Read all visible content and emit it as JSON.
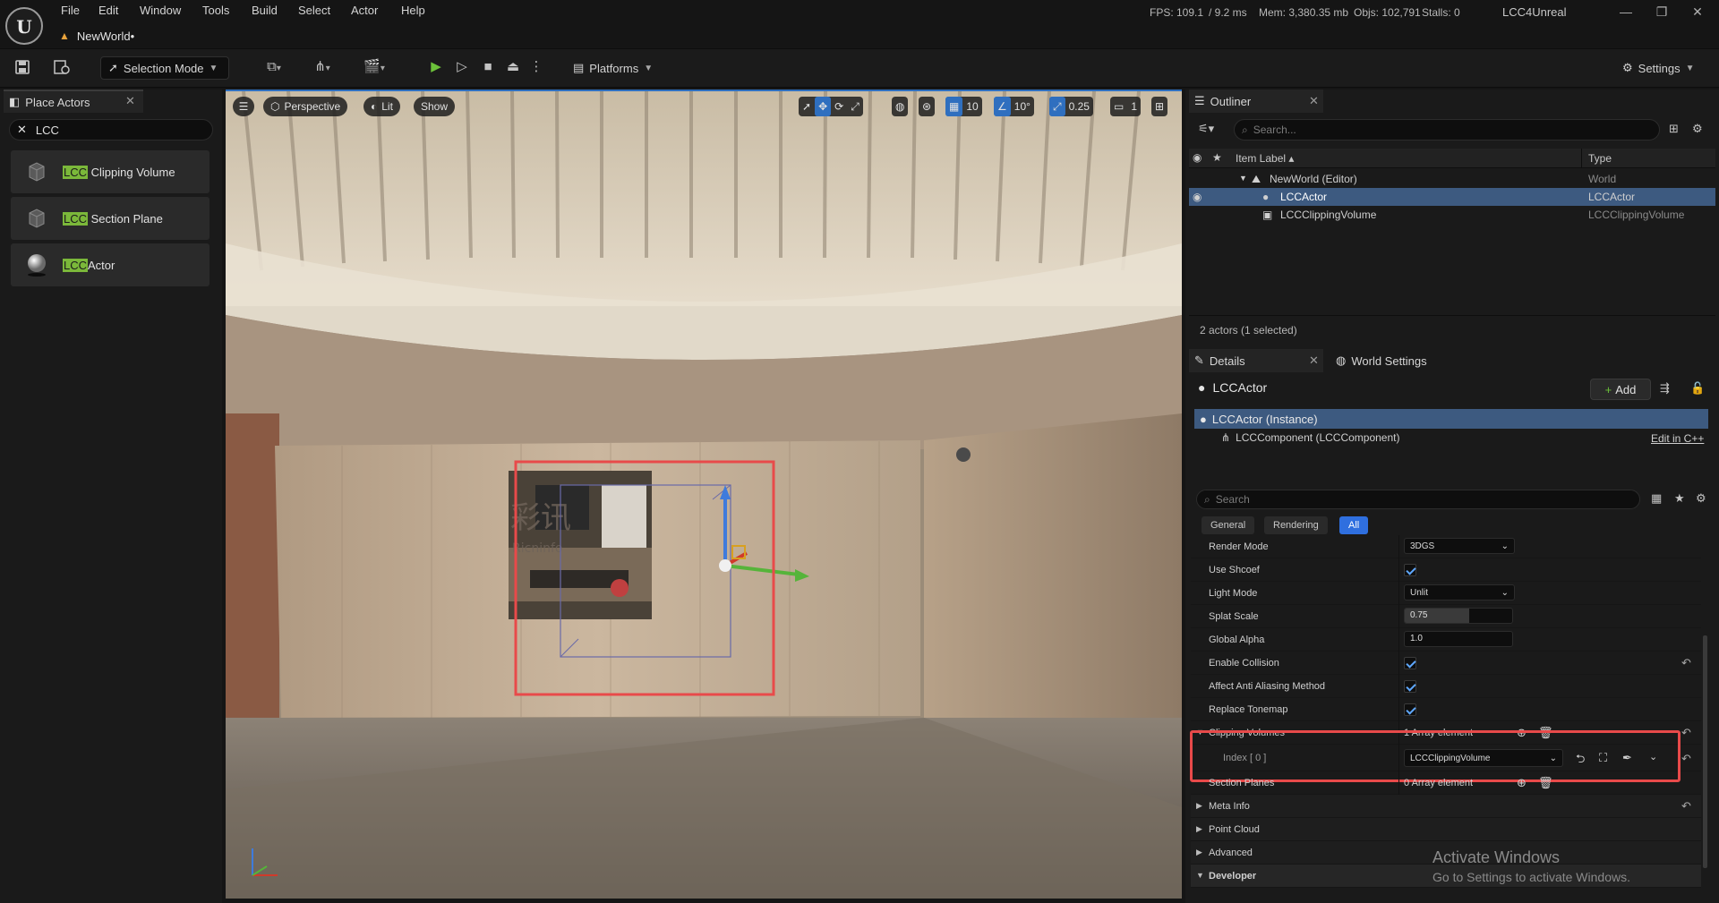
{
  "menu": [
    "File",
    "Edit",
    "Window",
    "Tools",
    "Build",
    "Select",
    "Actor",
    "Help"
  ],
  "level_tab": "NewWorld•",
  "stats": {
    "fps": "FPS: 109.1",
    "ms": "/ 9.2 ms",
    "mem": "Mem: 3,380.35 mb",
    "objs": "Objs: 102,791",
    "stalls": "Stalls: 0"
  },
  "app_name": "LCC4Unreal",
  "toolbar": {
    "selection_mode": "Selection Mode",
    "platforms": "Platforms",
    "settings": "Settings"
  },
  "place_actors": {
    "tab": "Place Actors",
    "search_value": "LCC",
    "items": [
      {
        "hl": "LCC",
        "rest": " Clipping Volume"
      },
      {
        "hl": "LCC",
        "rest": " Section Plane"
      },
      {
        "hl": "LCC",
        "rest": "Actor"
      }
    ]
  },
  "viewport": {
    "perspective": "Perspective",
    "lit": "Lit",
    "show": "Show",
    "grid_snap": "10",
    "rot_snap": "10°",
    "scale_snap": "0.25",
    "cam_speed": "1",
    "wall_text_1": "彩讯",
    "wall_text_2": "Ricninfo"
  },
  "outliner": {
    "tab": "Outliner",
    "search_placeholder": "Search...",
    "col_label": "Item Label ▴",
    "col_type": "Type",
    "rows": [
      {
        "label": "NewWorld (Editor)",
        "type": "World"
      },
      {
        "label": "LCCActor",
        "type": "LCCActor"
      },
      {
        "label": "LCCClippingVolume",
        "type": "LCCClippingVolume"
      }
    ],
    "count": "2 actors (1 selected)"
  },
  "details": {
    "tab": "Details",
    "world_settings_tab": "World Settings",
    "actor_name": "LCCActor",
    "add_label": "Add",
    "instance": "LCCActor (Instance)",
    "component": "LCCComponent (LCCComponent)",
    "edit_cpp": "Edit in C++",
    "search_placeholder": "Search",
    "filters": [
      "General",
      "Rendering",
      "All"
    ],
    "props": {
      "render_mode": {
        "name": "Render Mode",
        "value": "3DGS"
      },
      "use_shcoef": {
        "name": "Use Shcoef"
      },
      "light_mode": {
        "name": "Light Mode",
        "value": "Unlit"
      },
      "splat_scale": {
        "name": "Splat Scale",
        "value": "0.75",
        "fraction": 0.6
      },
      "global_alpha": {
        "name": "Global Alpha",
        "value": "1.0"
      },
      "enable_collision": {
        "name": "Enable Collision"
      },
      "affect_aa": {
        "name": "Affect Anti Aliasing Method"
      },
      "replace_tonemap": {
        "name": "Replace Tonemap"
      },
      "clipping_volumes": {
        "name": "Clipping Volumes",
        "value": "1 Array element"
      },
      "index0": {
        "name": "Index [ 0 ]",
        "value": "LCCClippingVolume"
      },
      "section_planes": {
        "name": "Section Planes",
        "value": "0 Array element"
      },
      "meta_info": {
        "name": "Meta Info"
      },
      "point_cloud": {
        "name": "Point Cloud"
      },
      "advanced": {
        "name": "Advanced"
      },
      "developer": {
        "name": "Developer"
      }
    }
  },
  "watermark": {
    "line1": "Activate Windows",
    "line2": "Go to Settings to activate Windows."
  },
  "colors": {
    "highlight_red": "#e84a4a",
    "selection_blue": "#3d5a80",
    "accent_blue": "#2f6fdf",
    "lcc_green": "#7bb83a"
  }
}
